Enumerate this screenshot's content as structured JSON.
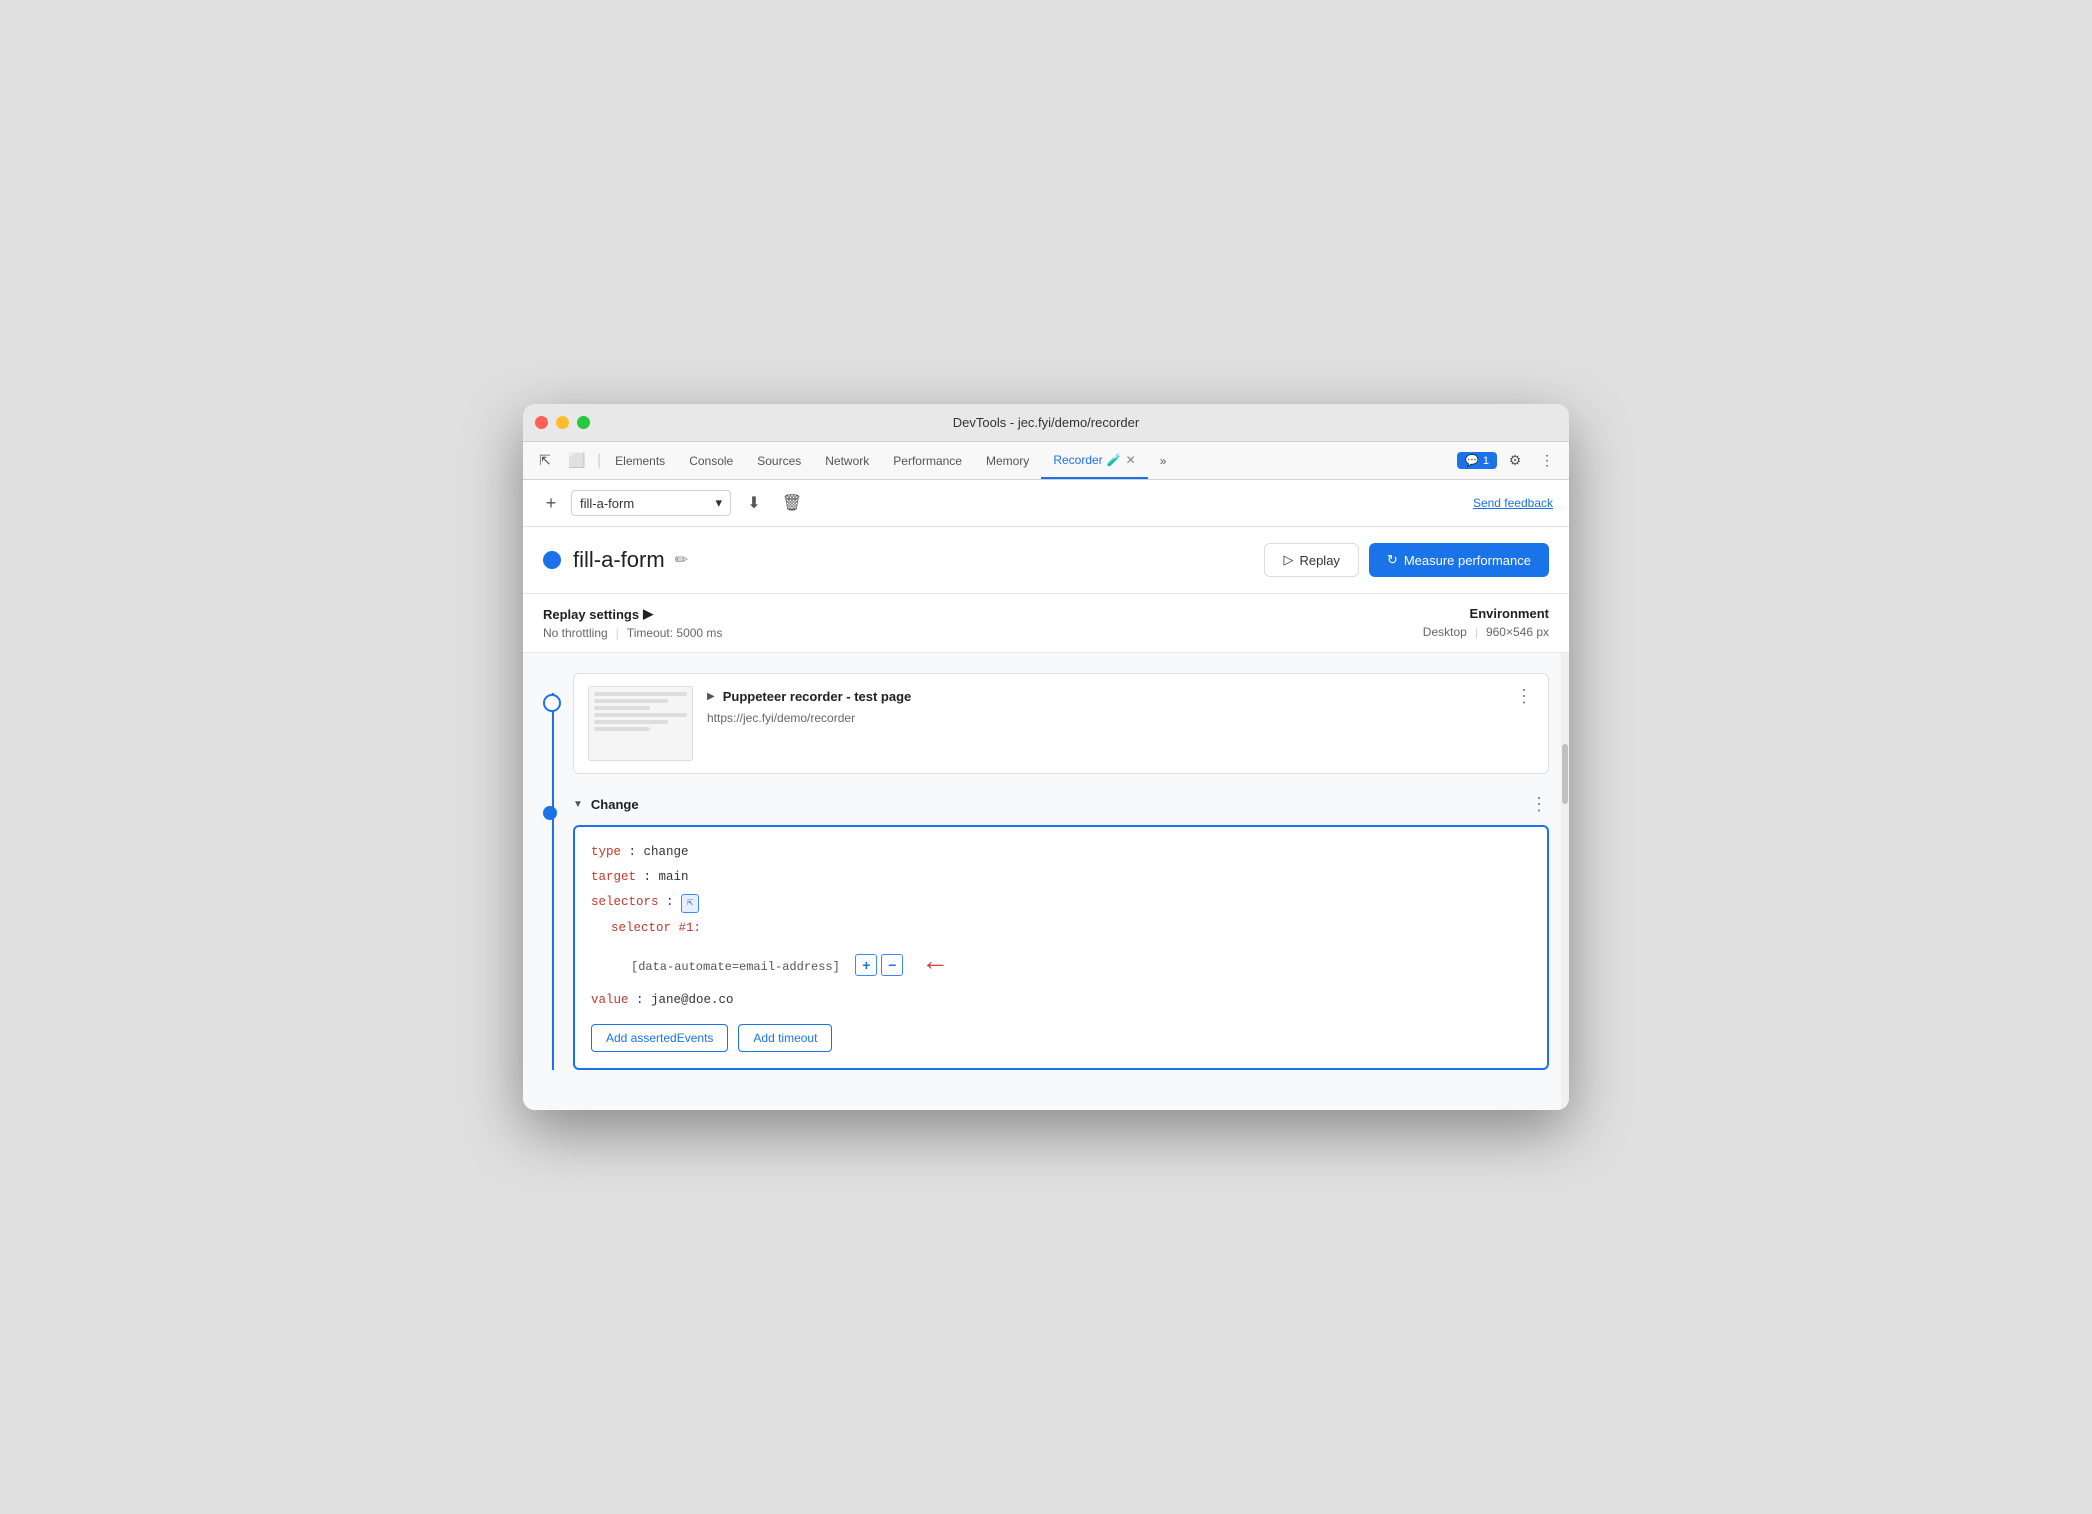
{
  "window": {
    "title": "DevTools - jec.fyi/demo/recorder"
  },
  "tabs": {
    "items": [
      {
        "label": "Elements",
        "active": false
      },
      {
        "label": "Console",
        "active": false
      },
      {
        "label": "Sources",
        "active": false
      },
      {
        "label": "Network",
        "active": false
      },
      {
        "label": "Performance",
        "active": false
      },
      {
        "label": "Memory",
        "active": false
      },
      {
        "label": "Recorder",
        "active": true
      }
    ],
    "chat_badge": "1",
    "more_label": "»"
  },
  "toolbar": {
    "add_label": "+",
    "recording_name": "fill-a-form",
    "chevron": "▾",
    "send_feedback": "Send feedback"
  },
  "recording": {
    "title": "fill-a-form",
    "replay_label": "Replay",
    "measure_label": "Measure performance"
  },
  "replay_settings": {
    "section_title": "Replay settings",
    "throttling": "No throttling",
    "timeout": "Timeout: 5000 ms",
    "environment_title": "Environment",
    "desktop": "Desktop",
    "resolution": "960×546 px"
  },
  "steps": {
    "step1": {
      "title": "Puppeteer recorder - test page",
      "url": "https://jec.fyi/demo/recorder"
    },
    "step2": {
      "title": "Change",
      "type_label": "type",
      "type_val": "change",
      "target_label": "target",
      "target_val": "main",
      "selectors_label": "selectors",
      "selector_num_label": "selector #1:",
      "selector_value": "[data-automate=email-address]",
      "value_label": "value",
      "value_val": "jane@doe.co",
      "add_events_label": "Add assertedEvents",
      "add_timeout_label": "Add timeout"
    }
  },
  "icons": {
    "expand_closed": "▶",
    "expand_open": "▼",
    "edit": "✏",
    "download": "⬇",
    "delete": "🗑",
    "replay_triangle": "▷",
    "measure_icon": "↻",
    "chat": "💬",
    "settings_gear": "⚙",
    "more_vert": "⋮",
    "cursor_icon": "⇱"
  },
  "colors": {
    "accent": "#1a73e8",
    "red_arrow": "#e53935",
    "code_key": "#c0392b"
  }
}
